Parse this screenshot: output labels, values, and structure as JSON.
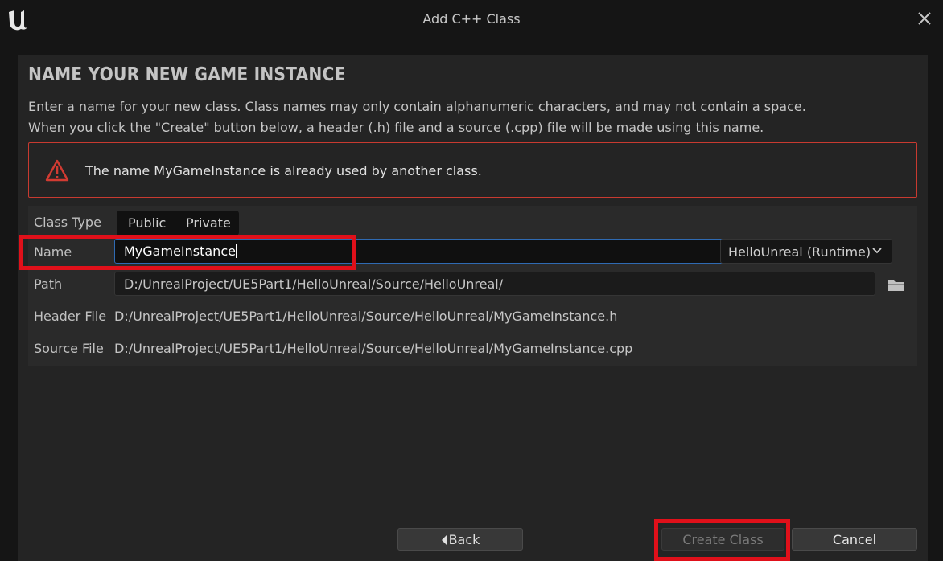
{
  "window": {
    "title": "Add C++ Class",
    "logo_icon": "unreal-logo-icon",
    "close_icon": "close-icon"
  },
  "header": {
    "heading": "NAME YOUR NEW GAME INSTANCE",
    "description_line1": "Enter a name for your new class. Class names may only contain alphanumeric characters, and may not contain a space.",
    "description_line2": "When you click the \"Create\" button below, a header (.h) file and a source (.cpp) file will be made using this name."
  },
  "error": {
    "icon": "warning-icon",
    "message": "The name MyGameInstance is already used by another class.",
    "color": "#c83a30"
  },
  "form": {
    "class_type_label": "Class Type",
    "class_type_options": [
      "Public",
      "Private"
    ],
    "name_label": "Name",
    "name_value": "MyGameInstance",
    "module_value": "HelloUnreal (Runtime)",
    "path_label": "Path",
    "path_value": "D:/UnrealProject/UE5Part1/HelloUnreal/Source/HelloUnreal/",
    "header_file_label": "Header File",
    "header_file_value": "D:/UnrealProject/UE5Part1/HelloUnreal/Source/HelloUnreal/MyGameInstance.h",
    "source_file_label": "Source File",
    "source_file_value": "D:/UnrealProject/UE5Part1/HelloUnreal/Source/HelloUnreal/MyGameInstance.cpp"
  },
  "buttons": {
    "back_label": "Back",
    "create_label": "Create Class",
    "cancel_label": "Cancel"
  },
  "colors": {
    "background": "#151515",
    "panel": "#242424",
    "focus_border": "#2f6ab2",
    "highlight": "#e0101a"
  }
}
